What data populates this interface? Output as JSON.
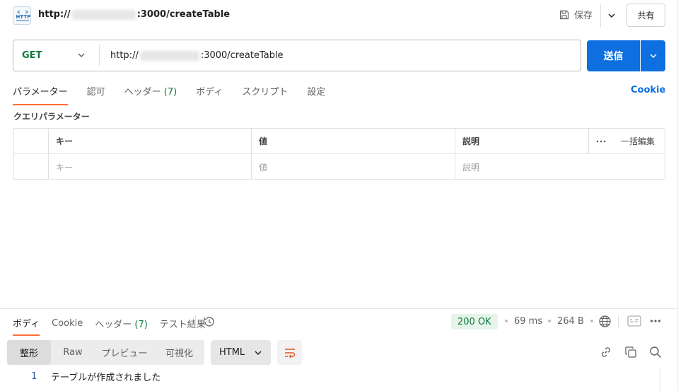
{
  "header": {
    "icon_label": "HTTP",
    "title_prefix": "http://",
    "title_suffix": ":3000/createTable",
    "save_label": "保存",
    "share_label": "共有"
  },
  "request": {
    "method": "GET",
    "url_prefix": "http://",
    "url_suffix": ":3000/createTable",
    "send_label": "送信"
  },
  "tabs": [
    {
      "label": "パラメーター",
      "count": ""
    },
    {
      "label": "認可",
      "count": ""
    },
    {
      "label": "ヘッダー",
      "count": "(7)"
    },
    {
      "label": "ボディ",
      "count": ""
    },
    {
      "label": "スクリプト",
      "count": ""
    },
    {
      "label": "設定",
      "count": ""
    }
  ],
  "cookie_link": "Cookie",
  "params": {
    "section_label": "クエリパラメーター",
    "headers": [
      "キー",
      "値",
      "説明"
    ],
    "placeholders": [
      "キー",
      "値",
      "説明"
    ],
    "bulk_edit": "一括編集"
  },
  "response": {
    "tabs": [
      {
        "label": "ボディ",
        "count": ""
      },
      {
        "label": "Cookie",
        "count": ""
      },
      {
        "label": "ヘッダー",
        "count": "(7)"
      },
      {
        "label": "テスト結果",
        "count": ""
      }
    ],
    "status": "200 OK",
    "time": "69 ms",
    "size": "264 B",
    "formats": [
      "整形",
      "Raw",
      "プレビュー",
      "可視化"
    ],
    "language": "HTML",
    "lines": [
      {
        "no": "1",
        "text": "テーブルが作成されました"
      }
    ]
  },
  "colors": {
    "accent": "#ff6c37",
    "primary": "#0d6fe0",
    "success": "#0b7a3e"
  }
}
